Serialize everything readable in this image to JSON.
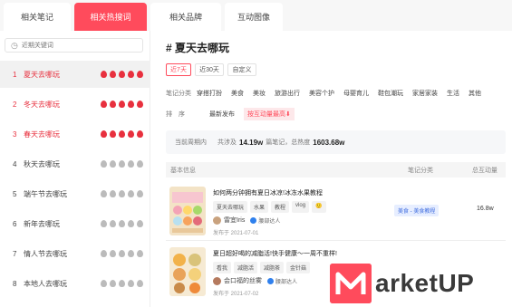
{
  "tabs": [
    {
      "label": "相关笔记"
    },
    {
      "label": "相关热搜词"
    },
    {
      "label": "相关品牌"
    },
    {
      "label": "互动图像"
    }
  ],
  "sidebar": {
    "recent_label": "近期关键词",
    "items": [
      {
        "rank": "1",
        "label": "夏天去哪玩",
        "hot": 5
      },
      {
        "rank": "2",
        "label": "冬天去哪玩",
        "hot": 5
      },
      {
        "rank": "3",
        "label": "春天去哪玩",
        "hot": 5
      },
      {
        "rank": "4",
        "label": "秋天去哪玩",
        "hot": 0
      },
      {
        "rank": "5",
        "label": "端午节去哪玩",
        "hot": 0
      },
      {
        "rank": "6",
        "label": "新年去哪玩",
        "hot": 0
      },
      {
        "rank": "7",
        "label": "情人节去哪玩",
        "hot": 0
      },
      {
        "rank": "8",
        "label": "本地人去哪玩",
        "hot": 0
      }
    ]
  },
  "main": {
    "title": "# 夏天去哪玩",
    "ranges": [
      "近7天",
      "近30天",
      "自定义"
    ],
    "category_label": "笔记分类",
    "categories": [
      "穿搭打扮",
      "美食",
      "美妆",
      "旅游出行",
      "美容个护",
      "母婴育儿",
      "鞋包潮玩",
      "家居家装",
      "生活",
      "其他"
    ],
    "sort_label": "排　序",
    "sort_options": [
      "最新发布",
      "按互动量最高⬇"
    ],
    "summary": {
      "period_label": "当前周期内",
      "notes_prefix": "共涉及",
      "notes_value": "14.19w",
      "notes_suffix": "篇笔记，总热度",
      "heat_value": "1603.68w"
    },
    "table_headers": {
      "info": "基本信息",
      "category": "笔记分类",
      "engagement": "总互动量"
    },
    "rows": [
      {
        "title": "如何两分钟拥有夏日冰凉!冰冻水果教程",
        "chips": [
          "夏天去哪玩",
          "水果",
          "教程",
          "vlog",
          "🙂"
        ],
        "author": "雷宜Iris",
        "badge": "腰部达人",
        "date": "发布于 2021-07-01",
        "category": "美食 - 美食教程",
        "value": "16.8w"
      },
      {
        "title": "夏日超好喝的减脂活!快手健康～一周不重样!",
        "chips": [
          "看我",
          "减脂活",
          "减脂茶",
          "金针菇"
        ],
        "author": "会口福的丝雾",
        "badge": "腰部达人",
        "date": "发布于 2021-07-02",
        "category": "",
        "value": ""
      }
    ]
  },
  "brand": {
    "text": "arketUP",
    "color": "#ff4b5c"
  }
}
